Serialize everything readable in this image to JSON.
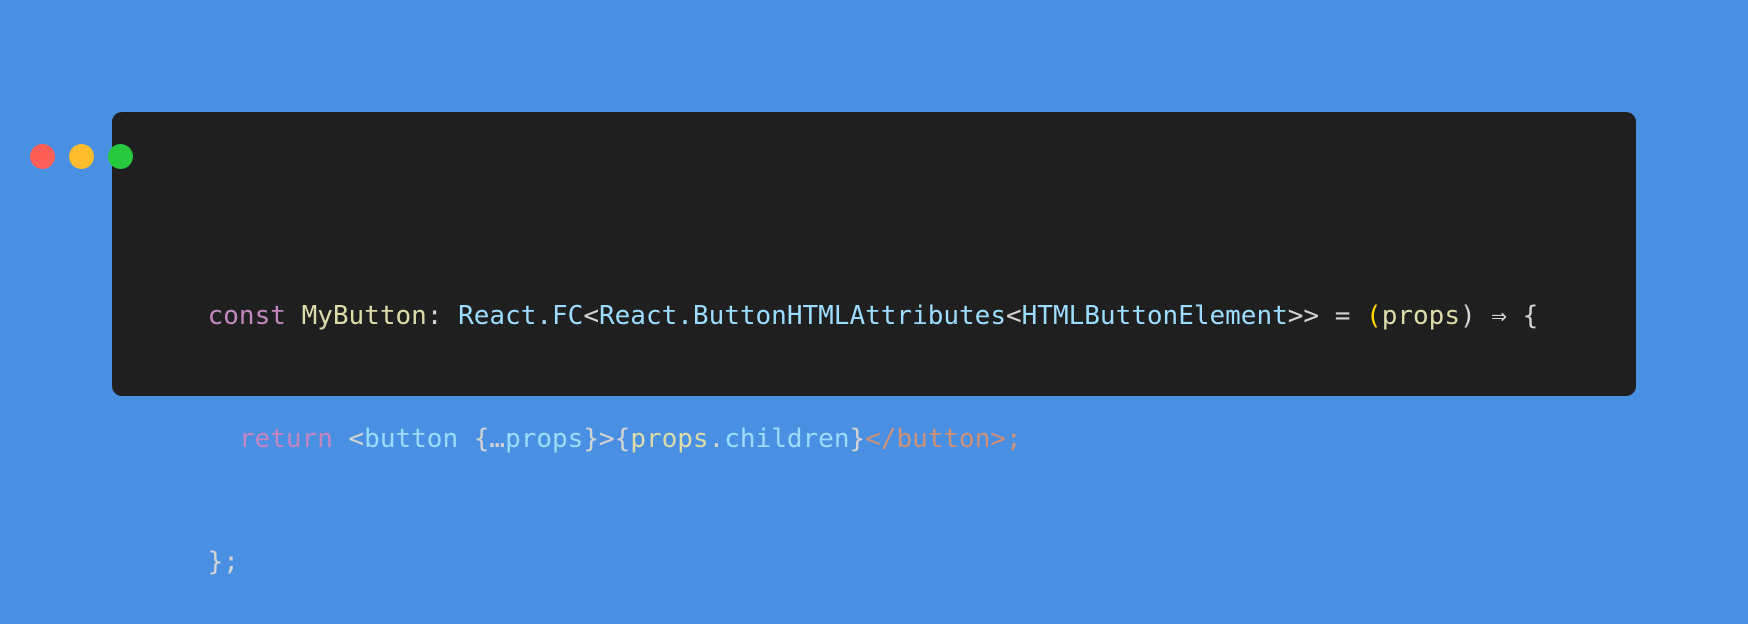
{
  "window": {
    "controls": {
      "close_color": "#ff5f56",
      "minimize_color": "#ffbd2e",
      "maximize_color": "#27c93f"
    }
  },
  "code": {
    "lines": [
      [
        {
          "text": "const",
          "kind": "keyword"
        },
        {
          "text": " ",
          "kind": "plain"
        },
        {
          "text": "MyButton",
          "kind": "name"
        },
        {
          "text": ": ",
          "kind": "plain"
        },
        {
          "text": "React.FC",
          "kind": "type"
        },
        {
          "text": "<",
          "kind": "plain"
        },
        {
          "text": "React.ButtonHTMLAttributes",
          "kind": "type"
        },
        {
          "text": "<",
          "kind": "plain"
        },
        {
          "text": "HTMLButtonElement",
          "kind": "type"
        },
        {
          "text": ">> = ",
          "kind": "plain"
        },
        {
          "text": "(",
          "kind": "plain"
        },
        {
          "text": "props",
          "kind": "name"
        },
        {
          "text": ") ⇒ {",
          "kind": "plain"
        }
      ],
      [
        {
          "text": "  ",
          "kind": "plain"
        },
        {
          "text": "return",
          "kind": "keyword"
        },
        {
          "text": " <",
          "kind": "plain"
        },
        {
          "text": "button",
          "kind": "var"
        },
        {
          "text": " {…",
          "kind": "plain"
        },
        {
          "text": "props",
          "kind": "var"
        },
        {
          "text": "}>{",
          "kind": "plain"
        },
        {
          "text": "props",
          "kind": "name"
        },
        {
          "text": ".",
          "kind": "plain"
        },
        {
          "text": "children",
          "kind": "var"
        },
        {
          "text": "}",
          "kind": "plain"
        },
        {
          "text": "</button>;",
          "kind": "tag"
        }
      ],
      [
        {
          "text": "};",
          "kind": "plain"
        }
      ]
    ]
  }
}
